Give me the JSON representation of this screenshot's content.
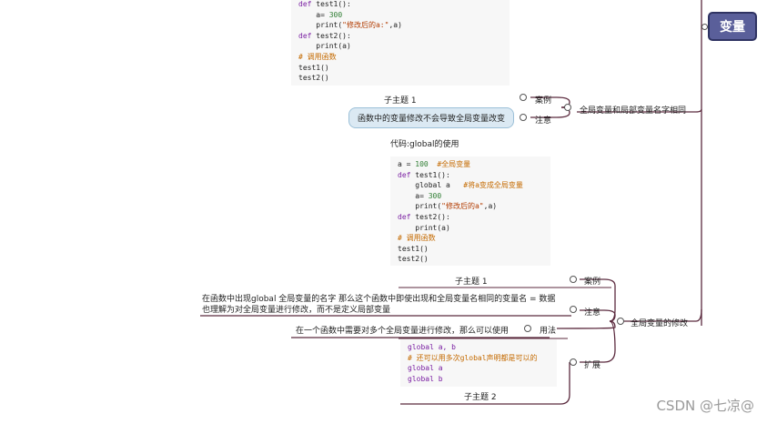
{
  "root": {
    "label": "变量"
  },
  "branch1": {
    "label": "全局变量和局部变量名字相同",
    "example_label": "案例",
    "note_label": "注意",
    "subtopic_label": "子主题 1",
    "note_text": "函数中的变量修改不会导致全局变量改变",
    "code_lines": [
      [
        {
          "t": "def ",
          "c": "kw"
        },
        {
          "t": "test1():",
          "c": ""
        }
      ],
      [
        {
          "t": "    a= ",
          "c": ""
        },
        {
          "t": "300",
          "c": "num"
        }
      ],
      [
        {
          "t": "    print(",
          "c": ""
        },
        {
          "t": "\"修改后的a:\"",
          "c": "str"
        },
        {
          "t": ",a)",
          "c": ""
        }
      ],
      [
        {
          "t": "def ",
          "c": "kw"
        },
        {
          "t": "test2():",
          "c": ""
        }
      ],
      [
        {
          "t": "    print(a)",
          "c": ""
        }
      ],
      [
        {
          "t": "# 调用函数",
          "c": "cmt"
        }
      ],
      [
        {
          "t": "test1()",
          "c": ""
        }
      ],
      [
        {
          "t": "test2()",
          "c": ""
        }
      ]
    ]
  },
  "branch2": {
    "label": "全局变量的修改",
    "example_label": "案例",
    "note_label": "注意",
    "usage_label": "用法",
    "extend_label": "扩展",
    "subtopic1_label": "子主题 1",
    "subtopic2_label": "子主题 2",
    "code_title": "代码:global的使用",
    "code_lines": [
      [
        {
          "t": "a = ",
          "c": ""
        },
        {
          "t": "100",
          "c": "num"
        },
        {
          "t": "  #全局变量",
          "c": "cmt"
        }
      ],
      [
        {
          "t": "def ",
          "c": "kw"
        },
        {
          "t": "test1():",
          "c": ""
        }
      ],
      [
        {
          "t": "    global a   ",
          "c": ""
        },
        {
          "t": "#将a变成全局变量",
          "c": "cmt"
        }
      ],
      [
        {
          "t": "    a= ",
          "c": ""
        },
        {
          "t": "300",
          "c": "num"
        }
      ],
      [
        {
          "t": "    print(",
          "c": ""
        },
        {
          "t": "\"修改后的a\"",
          "c": "str"
        },
        {
          "t": ",a)",
          "c": ""
        }
      ],
      [
        {
          "t": "def ",
          "c": "kw"
        },
        {
          "t": "test2():",
          "c": ""
        }
      ],
      [
        {
          "t": "    print(a)",
          "c": ""
        }
      ],
      [
        {
          "t": "# 调用函数",
          "c": "cmt"
        }
      ],
      [
        {
          "t": "test1()",
          "c": ""
        }
      ],
      [
        {
          "t": "test2()",
          "c": ""
        }
      ]
    ],
    "note_text_line1": "在函数中出现global 全局变量的名字 那么这个函数中即使出现和全局变量名相同的变量名 = 数据",
    "note_text_line2": "也理解为对全局变量进行修改，而不是定义局部变量",
    "usage_text": "在一个函数中需要对多个全局变量进行修改，那么可以使用",
    "extend_code_lines": [
      [
        {
          "t": "global a, b",
          "c": "kw"
        }
      ],
      [
        {
          "t": "# 还可以用多次global声明都是可以的",
          "c": "cmt"
        }
      ],
      [
        {
          "t": "global a",
          "c": "kw"
        }
      ],
      [
        {
          "t": "global b",
          "c": "kw"
        }
      ]
    ]
  },
  "watermark": "CSDN @七凉@"
}
